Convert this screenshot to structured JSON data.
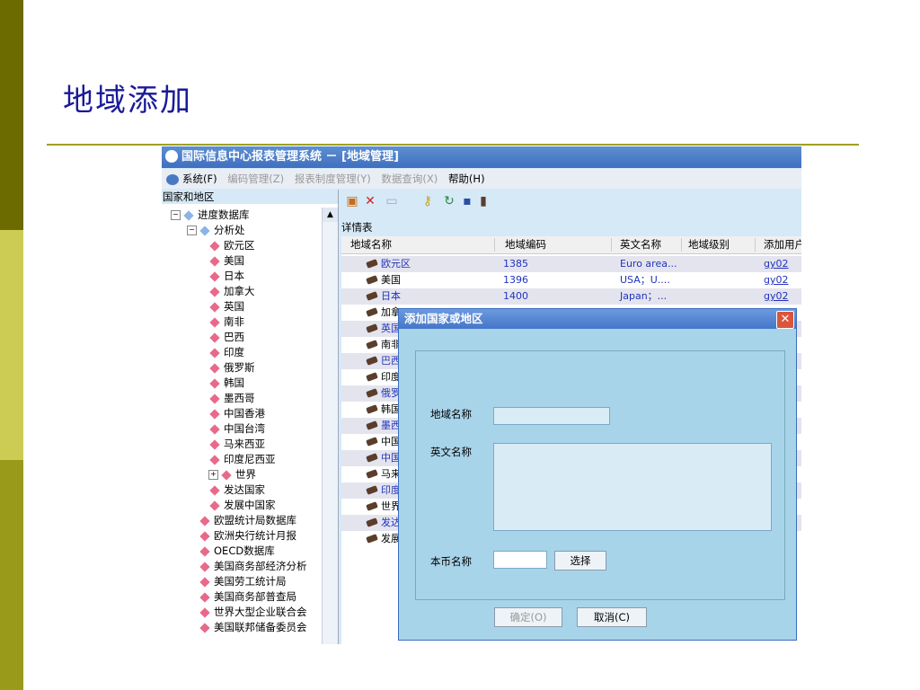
{
  "slide": {
    "title": "地域添加"
  },
  "window": {
    "title": "国际信息中心报表管理系统 － [地域管理]"
  },
  "menu": {
    "system": "系统(F)",
    "encode": "编码管理(Z)",
    "report": "报表制度管理(Y)",
    "query": "数据查询(X)",
    "help": "帮助(H)"
  },
  "left_panel": {
    "header": "国家和地区",
    "tree": [
      {
        "label": "进度数据库",
        "level": 0,
        "color": "blue"
      },
      {
        "label": "分析处",
        "level": 1,
        "color": "blue"
      },
      {
        "label": "欧元区",
        "level": 2,
        "color": "pink"
      },
      {
        "label": "美国",
        "level": 2,
        "color": "pink"
      },
      {
        "label": "日本",
        "level": 2,
        "color": "pink"
      },
      {
        "label": "加拿大",
        "level": 2,
        "color": "pink"
      },
      {
        "label": "英国",
        "level": 2,
        "color": "pink"
      },
      {
        "label": "南非",
        "level": 2,
        "color": "pink"
      },
      {
        "label": "巴西",
        "level": 2,
        "color": "pink"
      },
      {
        "label": "印度",
        "level": 2,
        "color": "pink"
      },
      {
        "label": "俄罗斯",
        "level": 2,
        "color": "pink"
      },
      {
        "label": "韩国",
        "level": 2,
        "color": "pink"
      },
      {
        "label": "墨西哥",
        "level": 2,
        "color": "pink"
      },
      {
        "label": "中国香港",
        "level": 2,
        "color": "pink"
      },
      {
        "label": "中国台湾",
        "level": 2,
        "color": "pink"
      },
      {
        "label": "马来西亚",
        "level": 2,
        "color": "pink"
      },
      {
        "label": "印度尼西亚",
        "level": 2,
        "color": "pink"
      },
      {
        "label": "世界",
        "level": 2,
        "color": "pink"
      },
      {
        "label": "发达国家",
        "level": 2,
        "color": "pink"
      },
      {
        "label": "发展中国家",
        "level": 2,
        "color": "pink"
      },
      {
        "label": "欧盟统计局数据库",
        "level": 1,
        "color": "pink"
      },
      {
        "label": "欧洲央行统计月报",
        "level": 1,
        "color": "pink"
      },
      {
        "label": "OECD数据库",
        "level": 1,
        "color": "pink"
      },
      {
        "label": "美国商务部经济分析",
        "level": 1,
        "color": "pink"
      },
      {
        "label": "美国劳工统计局",
        "level": 1,
        "color": "pink"
      },
      {
        "label": "美国商务部普查局",
        "level": 1,
        "color": "pink"
      },
      {
        "label": "世界大型企业联合会",
        "level": 1,
        "color": "pink"
      },
      {
        "label": "美国联邦储备委员会",
        "level": 1,
        "color": "pink"
      }
    ]
  },
  "toolbar": {
    "icons": [
      "add-icon",
      "delete-icon",
      "edit-icon",
      "find-icon",
      "refresh-icon",
      "save-icon",
      "exit-icon"
    ]
  },
  "details": {
    "title": "详情表",
    "columns": [
      "地域名称",
      "地域编码",
      "英文名称",
      "地域级别",
      "添加用户"
    ],
    "rows": [
      {
        "name": "欧元区",
        "code": "1385",
        "en": "Euro area...",
        "user": "gy02"
      },
      {
        "name": "美国",
        "code": "1396",
        "en": "USA；U....",
        "user": "gy02"
      },
      {
        "name": "日本",
        "code": "1400",
        "en": "Japan；...",
        "user": "gy02"
      },
      {
        "name": "加拿",
        "code": "",
        "en": "",
        "user": ""
      },
      {
        "name": "英国",
        "code": "",
        "en": "",
        "user": ""
      },
      {
        "name": "南非",
        "code": "",
        "en": "",
        "user": ""
      },
      {
        "name": "巴西",
        "code": "",
        "en": "",
        "user": ""
      },
      {
        "name": "印度",
        "code": "",
        "en": "",
        "user": ""
      },
      {
        "name": "俄罗",
        "code": "",
        "en": "",
        "user": ""
      },
      {
        "name": "韩国",
        "code": "",
        "en": "",
        "user": ""
      },
      {
        "name": "墨西",
        "code": "",
        "en": "",
        "user": ""
      },
      {
        "name": "中国",
        "code": "",
        "en": "",
        "user": ""
      },
      {
        "name": "中国",
        "code": "",
        "en": "",
        "user": ""
      },
      {
        "name": "马来",
        "code": "",
        "en": "",
        "user": ""
      },
      {
        "name": "印度",
        "code": "",
        "en": "",
        "user": ""
      },
      {
        "name": "世界",
        "code": "",
        "en": "",
        "user": ""
      },
      {
        "name": "发达",
        "code": "",
        "en": "",
        "user": ""
      },
      {
        "name": "发展",
        "code": "",
        "en": "",
        "user": ""
      }
    ]
  },
  "dialog": {
    "title": "添加国家或地区",
    "region_name_label": "地域名称",
    "region_name_value": "",
    "english_name_label": "英文名称",
    "english_name_value": "",
    "currency_label": "本币名称",
    "currency_value": "",
    "choose_label": "选择",
    "ok_label": "确定(O)",
    "cancel_label": "取消(C)"
  }
}
